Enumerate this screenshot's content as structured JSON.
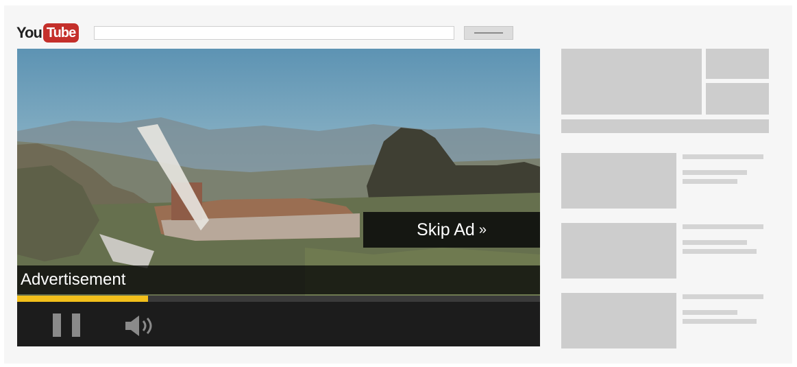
{
  "header": {
    "logo_you": "You",
    "logo_tube": "Tube",
    "search_placeholder": ""
  },
  "video": {
    "skip_ad_label": "Skip Ad",
    "skip_ad_arrows": "»",
    "ad_label": "Advertisement",
    "progress_fraction": 0.25,
    "icons": [
      "pause-icon",
      "volume-icon"
    ]
  },
  "colors": {
    "brand_red": "#c4302b",
    "progress_yellow": "#f2bf1b",
    "placeholder_gray": "#cdcdcd"
  }
}
